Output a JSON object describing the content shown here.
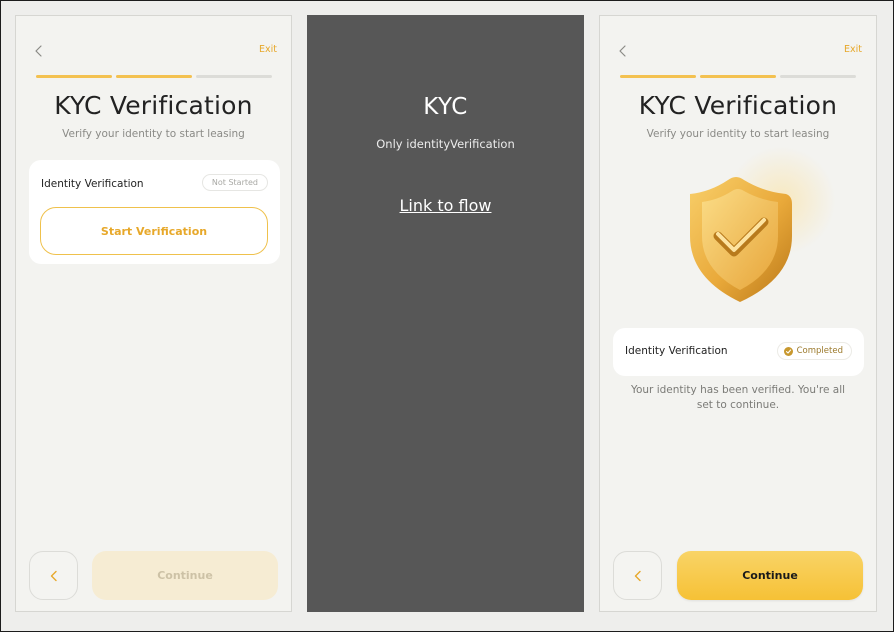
{
  "screen1": {
    "exit": "Exit",
    "title": "KYC Verification",
    "subtitle": "Verify your identity to start leasing",
    "card_label": "Identity Verification",
    "status": "Not Started",
    "start_button": "Start Verification",
    "continue": "Continue",
    "progress_completed_steps": 2,
    "progress_total_steps": 3
  },
  "middle": {
    "heading": "KYC",
    "subheading": "Only identityVerification",
    "link": "Link to flow"
  },
  "screen2": {
    "exit": "Exit",
    "title": "KYC Verification",
    "subtitle": "Verify your identity to start leasing",
    "card_label": "Identity Verification",
    "status": "Completed",
    "message": "Your identity has been verified. You're all set to continue.",
    "continue": "Continue",
    "progress_completed_steps": 2,
    "progress_total_steps": 3
  },
  "colors": {
    "accent": "#f3c150",
    "accent_text": "#e7a82a",
    "panel_bg": "#f3f3f0",
    "dark_panel": "#575757"
  },
  "icons": [
    "chevron-left-icon",
    "shield-check-icon",
    "check-circle-icon"
  ]
}
